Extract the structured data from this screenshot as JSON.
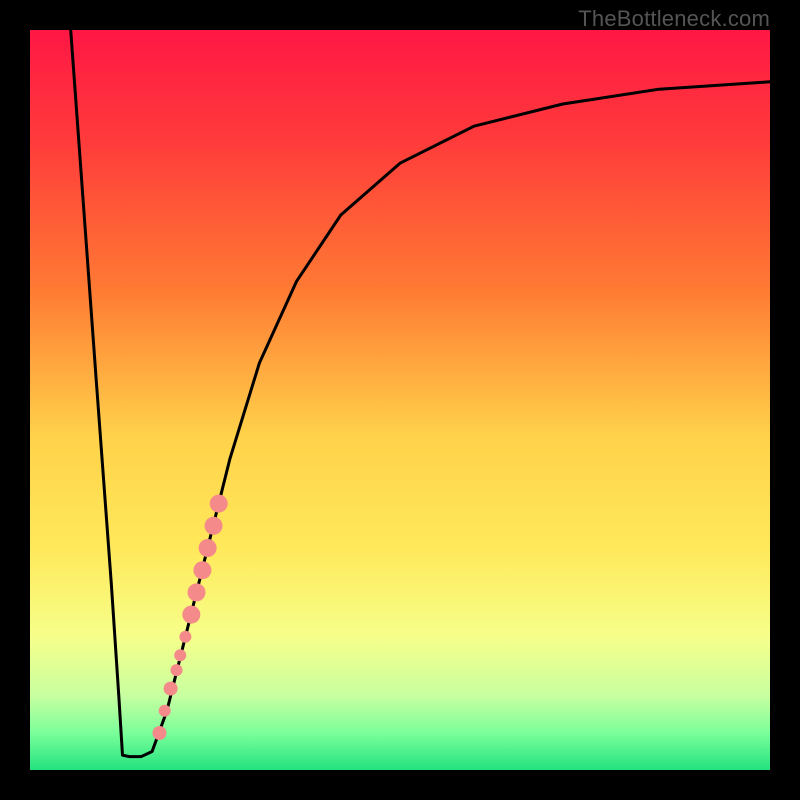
{
  "watermark": "TheBottleneck.com",
  "chart_data": {
    "type": "line",
    "title": "",
    "xlabel": "",
    "ylabel": "",
    "xlim": [
      0,
      100
    ],
    "ylim": [
      0,
      100
    ],
    "gradient_stops": [
      {
        "offset": 0.0,
        "color": "#ff1744"
      },
      {
        "offset": 0.15,
        "color": "#ff3b3b"
      },
      {
        "offset": 0.35,
        "color": "#ff7a33"
      },
      {
        "offset": 0.55,
        "color": "#ffd24a"
      },
      {
        "offset": 0.7,
        "color": "#ffe95a"
      },
      {
        "offset": 0.82,
        "color": "#f6ff8a"
      },
      {
        "offset": 0.9,
        "color": "#c8ffa0"
      },
      {
        "offset": 0.95,
        "color": "#7aff9a"
      },
      {
        "offset": 1.0,
        "color": "#23e27f"
      }
    ],
    "series": [
      {
        "name": "curve",
        "color": "#000000",
        "points": [
          {
            "x": 5.5,
            "y": 100.0
          },
          {
            "x": 9.0,
            "y": 52.0
          },
          {
            "x": 11.0,
            "y": 25.0
          },
          {
            "x": 12.0,
            "y": 10.0
          },
          {
            "x": 12.5,
            "y": 2.0
          },
          {
            "x": 13.5,
            "y": 1.8
          },
          {
            "x": 15.0,
            "y": 1.8
          },
          {
            "x": 16.5,
            "y": 2.5
          },
          {
            "x": 18.5,
            "y": 8.0
          },
          {
            "x": 21.0,
            "y": 18.0
          },
          {
            "x": 24.0,
            "y": 30.0
          },
          {
            "x": 27.0,
            "y": 42.0
          },
          {
            "x": 31.0,
            "y": 55.0
          },
          {
            "x": 36.0,
            "y": 66.0
          },
          {
            "x": 42.0,
            "y": 75.0
          },
          {
            "x": 50.0,
            "y": 82.0
          },
          {
            "x": 60.0,
            "y": 87.0
          },
          {
            "x": 72.0,
            "y": 90.0
          },
          {
            "x": 85.0,
            "y": 92.0
          },
          {
            "x": 100.0,
            "y": 93.0
          }
        ]
      },
      {
        "name": "highlight-dots",
        "color": "#f48a8a",
        "points": [
          {
            "x": 17.5,
            "y": 5.0,
            "r": 7
          },
          {
            "x": 18.2,
            "y": 8.0,
            "r": 6
          },
          {
            "x": 19.0,
            "y": 11.0,
            "r": 7
          },
          {
            "x": 19.8,
            "y": 13.5,
            "r": 6
          },
          {
            "x": 20.3,
            "y": 15.5,
            "r": 6
          },
          {
            "x": 21.0,
            "y": 18.0,
            "r": 6
          },
          {
            "x": 21.8,
            "y": 21.0,
            "r": 9
          },
          {
            "x": 22.5,
            "y": 24.0,
            "r": 9
          },
          {
            "x": 23.3,
            "y": 27.0,
            "r": 9
          },
          {
            "x": 24.0,
            "y": 30.0,
            "r": 9
          },
          {
            "x": 24.8,
            "y": 33.0,
            "r": 9
          },
          {
            "x": 25.5,
            "y": 36.0,
            "r": 9
          }
        ]
      }
    ]
  }
}
